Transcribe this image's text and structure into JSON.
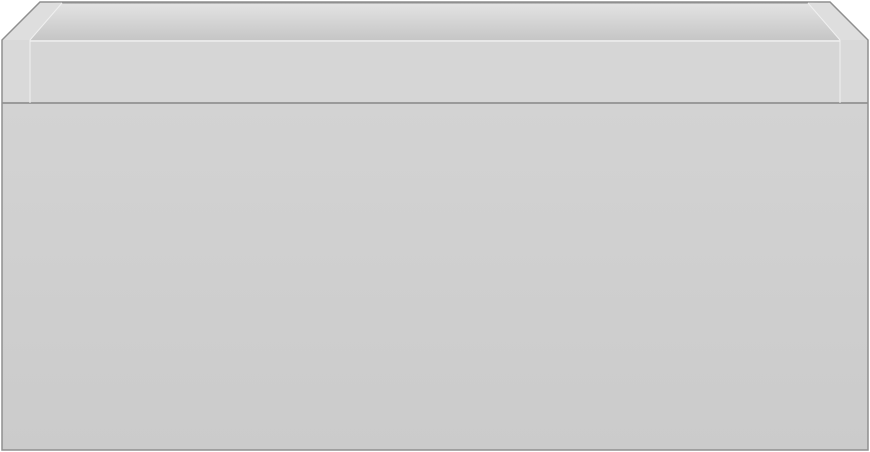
{
  "object": {
    "kind": "drawer-unit-render",
    "colors": {
      "background": "#ffffff",
      "outline": "#8f8f8f",
      "inner_back": "#c6c6c6",
      "rim_top": "#dedede",
      "inner_side": "#e3e3e3",
      "tray_front": "#d6d6d6",
      "tray_front_edge": "#e8e8e8",
      "side_post": "#d9d9d9",
      "side_post_highlight": "#f0f0f0",
      "drawer_front_top": "#d3d3d3",
      "drawer_front_bottom": "#cbcbcb",
      "gap_shadow": "#9a9a9a"
    }
  }
}
